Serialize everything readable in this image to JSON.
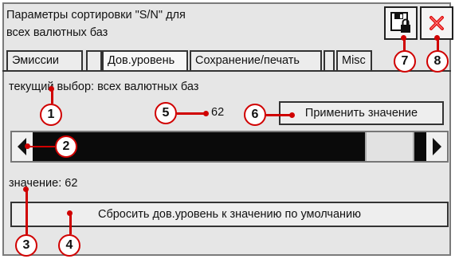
{
  "window": {
    "title": "Параметры сортировки \"S/N\" для\nвсех валютных баз"
  },
  "toolbar": {
    "save_icon": "save-lock-icon",
    "close_icon": "close-x-icon",
    "close_color": "#e01010"
  },
  "tabs": [
    {
      "label": "Эмиссии",
      "active": false
    },
    {
      "label": "",
      "active": false
    },
    {
      "label": "Дов.уровень",
      "active": true
    },
    {
      "label": "Сохранение/печать",
      "active": false
    },
    {
      "label": "",
      "active": false
    },
    {
      "label": "Misc",
      "active": false
    }
  ],
  "main": {
    "current_selection": "текущий выбор: всех валютных баз",
    "current_value": "62",
    "apply_button": "Применить значение",
    "slider_value": 62,
    "value_label": "значение: 62",
    "reset_button": "Сбросить дов.уровень к значению по умолчанию"
  },
  "callouts": [
    "1",
    "2",
    "3",
    "4",
    "5",
    "6",
    "7",
    "8"
  ],
  "accent_color": "#d00000"
}
